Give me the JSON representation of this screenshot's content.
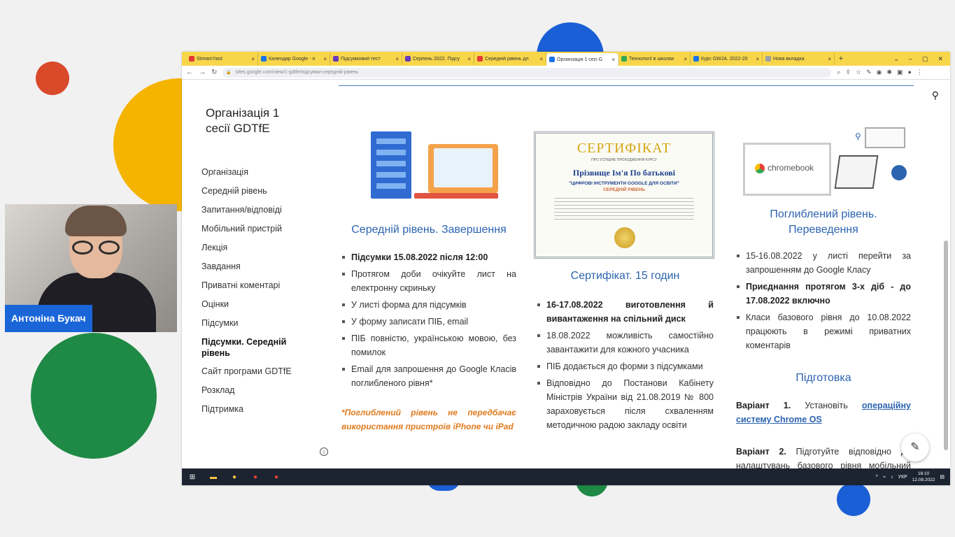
{
  "webcam": {
    "name": "Антоніна Букач"
  },
  "browser": {
    "tabs": [
      {
        "title": "StreamYard",
        "color": "#e53935"
      },
      {
        "title": "Календар Google - п",
        "color": "#1a73e8"
      },
      {
        "title": "Підсумковий тест",
        "color": "#673ab7"
      },
      {
        "title": "Серпень 2022. Підсу",
        "color": "#673ab7"
      },
      {
        "title": "Середній рівень дл",
        "color": "#e53935"
      },
      {
        "title": "Організація 1 сесі G",
        "color": "#1a73e8"
      },
      {
        "title": "Технології в школах",
        "color": "#34a853"
      },
      {
        "title": "Курс GWJA. 2022-20",
        "color": "#1a73e8"
      },
      {
        "title": "Нова вкладка",
        "color": "#9aa0a6"
      }
    ],
    "active_tab": 5,
    "url": "sites.google.com/view/1-gdtfe/підсумки-середній-рівень"
  },
  "site": {
    "title": "Організація 1 сесії GDTfE",
    "nav": [
      "Організація",
      "Середній рівень",
      "Запитання/відповіді",
      "Мобільний пристрій",
      "Лекція",
      "Завдання",
      "Приватні коментарі",
      "Оцінки",
      "Підсумки",
      "Підсумки. Середній рівень",
      "Сайт програми GDTfE",
      "Розклад",
      "Підтримка"
    ],
    "nav_active": 9
  },
  "col1": {
    "heading": "Середній рівень. Завершення",
    "items": [
      {
        "text": "Підсумки 15.08.2022 після 12:00",
        "bold": true
      },
      {
        "text": "Протягом доби очікуйте лист на електронну скриньку",
        "bold": false
      },
      {
        "text": "У листі форма для підсумків",
        "bold": false
      },
      {
        "text": "У форму записати ПІБ, email",
        "bold": false
      },
      {
        "text": "ПІБ повністю, українською мовою, без помилок",
        "bold": false
      },
      {
        "text": "Email для запрошення до Google Класів поглибленого рівня*",
        "bold": false
      }
    ],
    "note": "*Поглиблений рівень не передбачає використання пристроїв iPhone чи iPad"
  },
  "col2": {
    "certificate": {
      "title": "СЕРТИФІКАТ",
      "subtitle": "ПРО УСПІШНЕ ПРОХОДЖЕННЯ КУРСУ",
      "name": "Прізвище Ім'я По батькові",
      "program": "\"ЦИФРОВІ ІНСТРУМЕНТИ GOOGLE ДЛЯ ОСВІТИ\"",
      "level": "СЕРЕДНІЙ РІВЕНЬ"
    },
    "heading": "Сертифікат. 15 годин",
    "items": [
      {
        "text": "16-17.08.2022 виготовлення й вивантаження на спільний диск",
        "bold": true
      },
      {
        "text": "18.08.2022 можливість самостійно завантажити для кожного учасника",
        "bold": false
      },
      {
        "text": "ПІБ додається до форми з підсумками",
        "bold": false
      },
      {
        "text": "Відповідно до Постанови Кабінету Міністрів України від 21.08.2019 № 800 зараховується після схваленням методичною радою закладу освіти",
        "bold": false
      }
    ]
  },
  "col3": {
    "chromebook_label": "chromebook",
    "heading": "Поглиблений рівень. Переведення",
    "items": [
      {
        "text": "15-16.08.2022 у листі перейти за запрошенням до Google Класу",
        "bold": false
      },
      {
        "text": "Приєднання протягом 3-х діб - до 17.08.2022 включно",
        "bold": true
      },
      {
        "text": "Класи базового рівня до 10.08.2022 працюють в режимі приватних коментарів",
        "bold": false
      }
    ],
    "prep_heading": "Підготовка",
    "variant1_label": "Варіант 1.",
    "variant1_text": "Установіть",
    "variant1_link": "операційну систему Chrome OS",
    "variant2_label": "Варіант 2.",
    "variant2_text": "Підготуйте відповідно до налаштувань базового рівня мобільний пристрій Android*"
  },
  "taskbar": {
    "lang": "УКР",
    "time": "16:10",
    "date": "12.08.2022"
  }
}
